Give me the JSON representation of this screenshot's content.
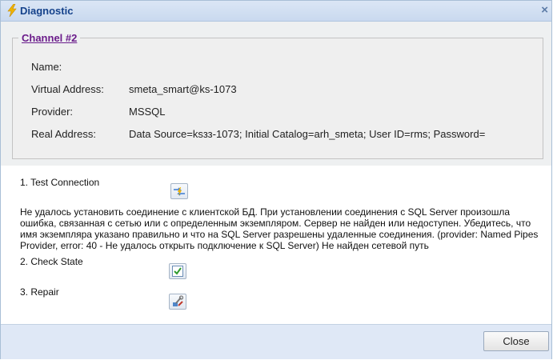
{
  "window": {
    "title": "Diagnostic",
    "close_glyph": "×",
    "title_icon": "lightning-icon"
  },
  "channel": {
    "legend": "Channel #2",
    "fields": [
      {
        "label": "Name:",
        "value": ""
      },
      {
        "label": "Virtual Address:",
        "value": "smeta_smart@ks-1073"
      },
      {
        "label": "Provider:",
        "value": "MSSQL"
      },
      {
        "label": "Real Address:",
        "value": "Data Source=ksзз-1073; Initial Catalog=arh_smeta; User ID=rms; Password="
      }
    ]
  },
  "steps": [
    {
      "label": "1. Test Connection",
      "icon": "test-connection-icon"
    },
    {
      "label": "2. Check State",
      "icon": "check-state-icon"
    },
    {
      "label": "3. Repair",
      "icon": "repair-icon"
    }
  ],
  "error_message": "Не удалось установить соединение с клиентской БД. При установлении соединения с SQL Server произошла ошибка, связанная с сетью или с определенным экземпляром. Сервер не найден или недоступен. Убедитесь, что имя экземпляра указано правильно и что на SQL Server разрешены удаленные соединения. (provider: Named Pipes Provider, error: 40 - Не удалось открыть подключение к SQL Server) Не найден сетевой путь",
  "footer": {
    "close_label": "Close"
  }
}
